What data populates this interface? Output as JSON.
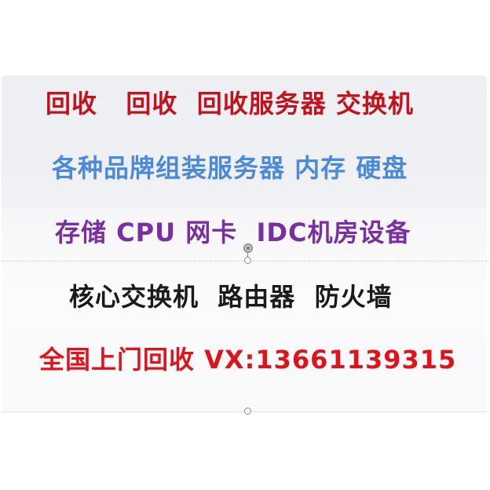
{
  "lines": [
    {
      "text": "回收   回收  回收服务器 交换机",
      "color": "#c4121c"
    },
    {
      "text": "各种品牌组装服务器 内存 硬盘",
      "color": "#4a8ad8"
    },
    {
      "text": "存储 CPU 网卡  IDC机房设备",
      "color": "#7a2fa0"
    },
    {
      "text": "核心交换机  路由器  防火墙",
      "color": "#1a1a1a"
    },
    {
      "text": "全国上门回收 VX:13661139315",
      "color": "#e0131b"
    }
  ],
  "colors": {
    "panel_top": "#eeeff3",
    "panel_bottom": "#fafafb",
    "handle": "#8a8a8a"
  },
  "icons": {
    "rotate_handle": "rotate-handle-icon",
    "resize_handle": "resize-handle-icon"
  }
}
